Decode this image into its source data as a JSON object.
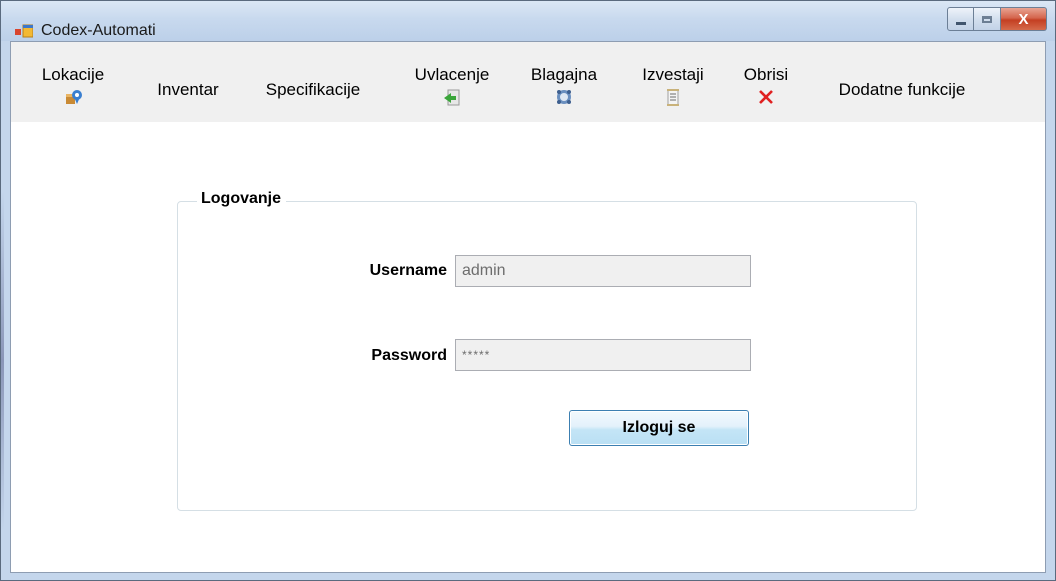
{
  "window": {
    "title": "Codex-Automati",
    "close_glyph": "X",
    "icons": {
      "app": "app-window-icon",
      "minimize": "minimize-icon",
      "maximize": "maximize-icon",
      "close": "close-icon"
    }
  },
  "menu": {
    "items": [
      {
        "label": "Lokacije",
        "icon": "location-icon"
      },
      {
        "label": "Inventar"
      },
      {
        "label": "Specifikacije"
      },
      {
        "label": "Uvlacenje",
        "icon": "import-arrow-icon"
      },
      {
        "label": "Blagajna",
        "icon": "cashier-icon"
      },
      {
        "label": "Izvestaji",
        "icon": "report-icon"
      },
      {
        "label": "Obrisi",
        "icon": "delete-x-icon"
      },
      {
        "label": "Dodatne funkcije"
      }
    ]
  },
  "login": {
    "group_title": "Logovanje",
    "username_label": "Username",
    "username_value": "admin",
    "password_label": "Password",
    "password_value": "*****",
    "logout_button": "Izloguj se"
  },
  "colors": {
    "title_bar": "#c8d9ee",
    "menu_background": "#f0f0f0",
    "close_button": "#c43f22",
    "button_border": "#3c7fb1"
  }
}
